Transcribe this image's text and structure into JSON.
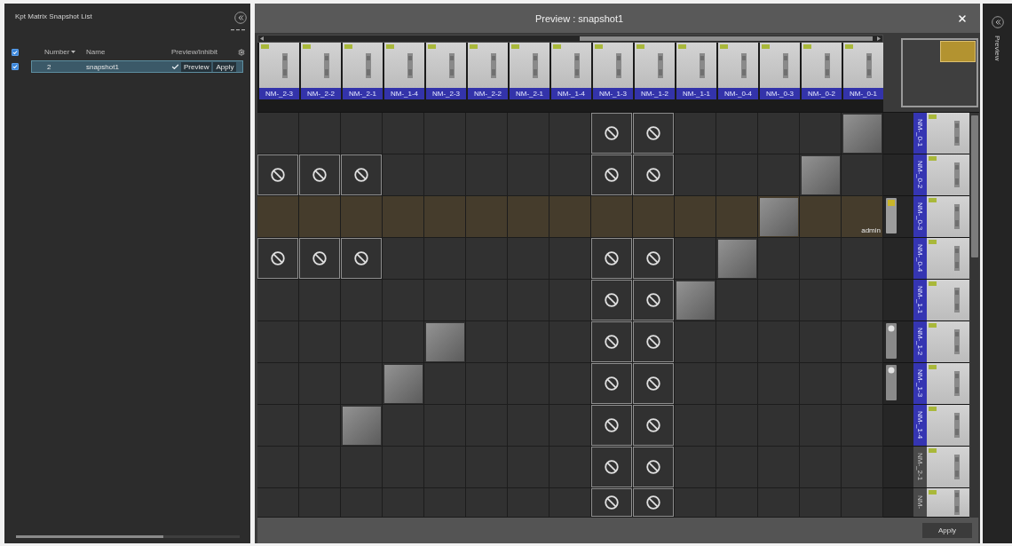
{
  "snapshot_list": {
    "title": "Kpt Matrix Snapshot List",
    "select_all": {
      "checked": true
    },
    "columns": [
      {
        "label": "Number",
        "sorted": true
      },
      {
        "label": "Name",
        "sorted": false
      },
      {
        "label": "Preview/Inhibit",
        "sorted": false
      }
    ],
    "rows": [
      {
        "checked": true,
        "selected": true,
        "number": "2",
        "name": "snapshot1",
        "preview_inhibit": true,
        "actions": [
          "Preview",
          "Apply"
        ]
      }
    ]
  },
  "preview": {
    "title": "Preview : snapshot1",
    "columns": [
      "NM-_2-3",
      "NM-_2-2",
      "NM-_2-1",
      "NM-_1-4",
      "NM-_2-3",
      "NM-_2-2",
      "NM-_2-1",
      "NM-_1-4",
      "NM-_1-3",
      "NM-_1-2",
      "NM-_1-1",
      "NM-_0-4",
      "NM-_0-3",
      "NM-_0-2",
      "NM-_0-1"
    ],
    "rows": [
      {
        "label": "NM-_0-1",
        "active": true,
        "selected": false,
        "cells": [
          {
            "kind": "empty"
          },
          {
            "kind": "empty"
          },
          {
            "kind": "empty"
          },
          {
            "kind": "empty"
          },
          {
            "kind": "empty"
          },
          {
            "kind": "empty"
          },
          {
            "kind": "empty"
          },
          {
            "kind": "empty"
          },
          {
            "kind": "inhibit"
          },
          {
            "kind": "inhibit"
          },
          {
            "kind": "empty"
          },
          {
            "kind": "empty"
          },
          {
            "kind": "empty"
          },
          {
            "kind": "empty"
          },
          {
            "kind": "route"
          }
        ]
      },
      {
        "label": "NM-_0-2",
        "active": true,
        "selected": false,
        "cells": [
          {
            "kind": "inhibit"
          },
          {
            "kind": "inhibit"
          },
          {
            "kind": "inhibit"
          },
          {
            "kind": "empty"
          },
          {
            "kind": "empty"
          },
          {
            "kind": "empty"
          },
          {
            "kind": "empty"
          },
          {
            "kind": "empty"
          },
          {
            "kind": "inhibit"
          },
          {
            "kind": "inhibit"
          },
          {
            "kind": "empty"
          },
          {
            "kind": "empty"
          },
          {
            "kind": "empty"
          },
          {
            "kind": "route"
          },
          {
            "kind": "empty"
          }
        ]
      },
      {
        "label": "NM-_0-3",
        "active": true,
        "selected": true,
        "tag": {
          "kind": "warning"
        },
        "user": "admin",
        "cells": [
          {
            "kind": "empty"
          },
          {
            "kind": "empty"
          },
          {
            "kind": "empty"
          },
          {
            "kind": "empty"
          },
          {
            "kind": "empty"
          },
          {
            "kind": "empty"
          },
          {
            "kind": "empty"
          },
          {
            "kind": "empty"
          },
          {
            "kind": "empty"
          },
          {
            "kind": "empty"
          },
          {
            "kind": "empty"
          },
          {
            "kind": "empty"
          },
          {
            "kind": "route"
          },
          {
            "kind": "empty"
          },
          {
            "kind": "empty"
          }
        ]
      },
      {
        "label": "NM-_0-4",
        "active": true,
        "selected": false,
        "cells": [
          {
            "kind": "inhibit"
          },
          {
            "kind": "inhibit"
          },
          {
            "kind": "inhibit"
          },
          {
            "kind": "empty"
          },
          {
            "kind": "empty"
          },
          {
            "kind": "empty"
          },
          {
            "kind": "empty"
          },
          {
            "kind": "empty"
          },
          {
            "kind": "inhibit"
          },
          {
            "kind": "inhibit"
          },
          {
            "kind": "empty"
          },
          {
            "kind": "route"
          },
          {
            "kind": "empty"
          },
          {
            "kind": "empty"
          },
          {
            "kind": "empty"
          }
        ]
      },
      {
        "label": "NM-_1-1",
        "active": true,
        "selected": false,
        "cells": [
          {
            "kind": "empty"
          },
          {
            "kind": "empty"
          },
          {
            "kind": "empty"
          },
          {
            "kind": "empty"
          },
          {
            "kind": "empty"
          },
          {
            "kind": "empty"
          },
          {
            "kind": "empty"
          },
          {
            "kind": "empty"
          },
          {
            "kind": "inhibit"
          },
          {
            "kind": "inhibit"
          },
          {
            "kind": "route"
          },
          {
            "kind": "empty"
          },
          {
            "kind": "empty"
          },
          {
            "kind": "empty"
          },
          {
            "kind": "empty"
          }
        ]
      },
      {
        "label": "NM-_1-2",
        "active": true,
        "selected": false,
        "tag": {
          "kind": "info"
        },
        "cells": [
          {
            "kind": "empty"
          },
          {
            "kind": "empty"
          },
          {
            "kind": "empty"
          },
          {
            "kind": "empty"
          },
          {
            "kind": "route"
          },
          {
            "kind": "empty"
          },
          {
            "kind": "empty"
          },
          {
            "kind": "empty"
          },
          {
            "kind": "inhibit"
          },
          {
            "kind": "inhibit"
          },
          {
            "kind": "empty"
          },
          {
            "kind": "empty"
          },
          {
            "kind": "empty"
          },
          {
            "kind": "empty"
          },
          {
            "kind": "empty"
          }
        ]
      },
      {
        "label": "NM-_1-3",
        "active": true,
        "selected": false,
        "tag": {
          "kind": "info"
        },
        "cells": [
          {
            "kind": "empty"
          },
          {
            "kind": "empty"
          },
          {
            "kind": "empty"
          },
          {
            "kind": "route"
          },
          {
            "kind": "empty"
          },
          {
            "kind": "empty"
          },
          {
            "kind": "empty"
          },
          {
            "kind": "empty"
          },
          {
            "kind": "inhibit"
          },
          {
            "kind": "inhibit"
          },
          {
            "kind": "empty"
          },
          {
            "kind": "empty"
          },
          {
            "kind": "empty"
          },
          {
            "kind": "empty"
          },
          {
            "kind": "empty"
          }
        ]
      },
      {
        "label": "NM-_1-4",
        "active": true,
        "selected": false,
        "cells": [
          {
            "kind": "empty"
          },
          {
            "kind": "empty"
          },
          {
            "kind": "route"
          },
          {
            "kind": "empty"
          },
          {
            "kind": "empty"
          },
          {
            "kind": "empty"
          },
          {
            "kind": "empty"
          },
          {
            "kind": "empty"
          },
          {
            "kind": "inhibit"
          },
          {
            "kind": "inhibit"
          },
          {
            "kind": "empty"
          },
          {
            "kind": "empty"
          },
          {
            "kind": "empty"
          },
          {
            "kind": "empty"
          },
          {
            "kind": "empty"
          }
        ]
      },
      {
        "label": "NM-_2-1",
        "active": false,
        "selected": false,
        "cells": [
          {
            "kind": "empty"
          },
          {
            "kind": "empty"
          },
          {
            "kind": "empty"
          },
          {
            "kind": "empty"
          },
          {
            "kind": "empty"
          },
          {
            "kind": "empty"
          },
          {
            "kind": "empty"
          },
          {
            "kind": "empty"
          },
          {
            "kind": "inhibit"
          },
          {
            "kind": "inhibit"
          },
          {
            "kind": "empty"
          },
          {
            "kind": "empty"
          },
          {
            "kind": "empty"
          },
          {
            "kind": "empty"
          },
          {
            "kind": "empty"
          }
        ]
      },
      {
        "label": "NM-",
        "active": false,
        "selected": false,
        "cells": [
          {
            "kind": "empty"
          },
          {
            "kind": "empty"
          },
          {
            "kind": "empty"
          },
          {
            "kind": "empty"
          },
          {
            "kind": "empty"
          },
          {
            "kind": "empty"
          },
          {
            "kind": "empty"
          },
          {
            "kind": "empty"
          },
          {
            "kind": "inhibit"
          },
          {
            "kind": "inhibit"
          },
          {
            "kind": "empty"
          },
          {
            "kind": "empty"
          },
          {
            "kind": "empty"
          },
          {
            "kind": "empty"
          },
          {
            "kind": "empty"
          }
        ]
      }
    ],
    "apply_button": "Apply"
  },
  "side_panel": {
    "label": "Preview"
  }
}
